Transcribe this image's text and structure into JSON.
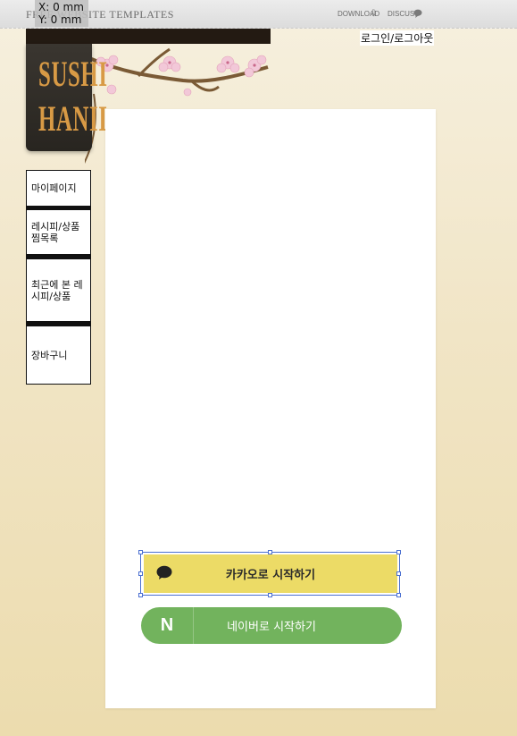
{
  "topbar": {
    "title": "FREE WEBSITE TEMPLATES",
    "coords": {
      "x": "X: 0 mm",
      "y": "Y: 0 mm"
    },
    "download_label": "DOWNLOAD",
    "discuss_label": "DISCUSS"
  },
  "header": {
    "login_link": "로그인/로그아웃"
  },
  "logo": {
    "line1": "SUSHI",
    "line2": "HANII"
  },
  "side_menu": {
    "items": [
      {
        "label": "마이페이지"
      },
      {
        "label": "레시피/상품 찜목록"
      },
      {
        "label": "최근에 본 레시피/상품"
      },
      {
        "label": "장바구니"
      }
    ]
  },
  "login_buttons": {
    "kakao_label": "카카오로 시작하기",
    "naver_label": "네이버로 시작하기",
    "naver_mark": "N",
    "kakao_color": "#ecdb66",
    "naver_color": "#72b35d"
  }
}
